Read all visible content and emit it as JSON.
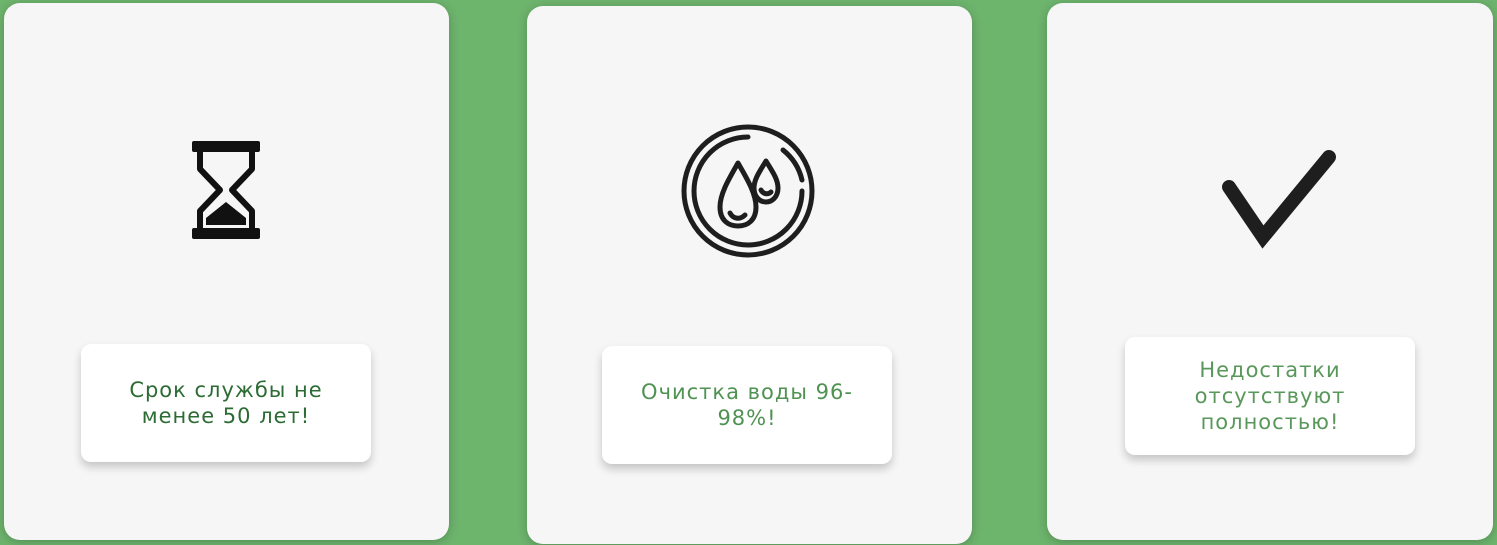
{
  "colors": {
    "page_background": "#6db46d",
    "card_background": "#f6f6f6",
    "label_background": "#ffffff",
    "icon_color": "#1e1e1e",
    "text_dark_green": "#2c6b33",
    "text_green": "#4f9252"
  },
  "cards": [
    {
      "icon": "hourglass-icon",
      "text": "Срок службы не менее 50 лет!"
    },
    {
      "icon": "water-drops-icon",
      "text": "Очистка воды 96-98%!"
    },
    {
      "icon": "checkmark-icon",
      "text": "Недостатки отсутствуют полностью!"
    }
  ]
}
